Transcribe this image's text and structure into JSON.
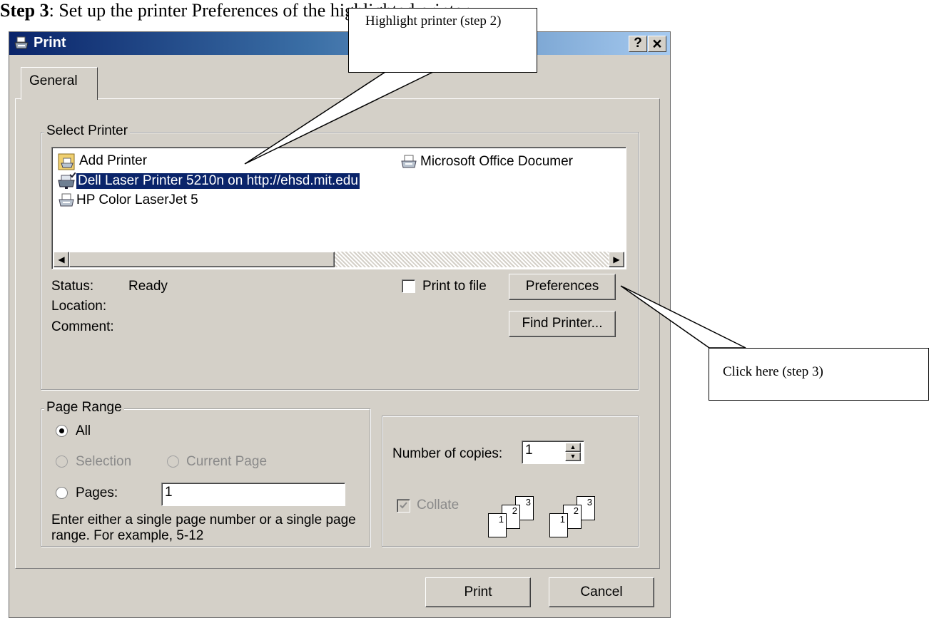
{
  "top_text": {
    "bold": "Step 3",
    "rest": ": Set up the printer Preferences of the highlighted printer"
  },
  "window": {
    "title": "Print",
    "help_label": "?",
    "close_label": "×"
  },
  "tabs": [
    {
      "label": "General"
    }
  ],
  "select_printer": {
    "legend": "Select Printer",
    "printers": [
      {
        "label": "Add Printer",
        "icon": "add-printer-icon"
      },
      {
        "label": "Dell Laser Printer 5210n on http://ehsd.mit.edu",
        "icon": "network-printer-icon",
        "selected": true
      },
      {
        "label": "HP Color LaserJet 5",
        "icon": "printer-icon"
      },
      {
        "label": "Microsoft Office Documer",
        "icon": "printer-icon"
      }
    ],
    "status_label": "Status:",
    "status_value": "Ready",
    "location_label": "Location:",
    "comment_label": "Comment:",
    "print_to_file_label": "Print to file",
    "print_to_file_checked": false,
    "preferences_label": "Preferences",
    "find_printer_label": "Find Printer..."
  },
  "page_range": {
    "legend": "Page Range",
    "all_label": "All",
    "all_selected": true,
    "selection_label": "Selection",
    "current_page_label": "Current Page",
    "pages_label": "Pages:",
    "pages_value": "1",
    "hint": "Enter either a single page number or a single page range.  For example, 5-12"
  },
  "copies": {
    "label": "Number of copies:",
    "value": "1",
    "collate_label": "Collate",
    "collate_checked": true,
    "collate_sheets": [
      "1",
      "2",
      "3"
    ]
  },
  "buttons": {
    "print_label": "Print",
    "cancel_label": "Cancel"
  },
  "callouts": {
    "step2": "Highlight printer (step 2)",
    "step3": "Click here (step 3)"
  },
  "colors": {
    "selection": "#0a246a",
    "dialog_bg": "#d4d0c8",
    "title_start": "#0a246a",
    "title_end": "#a6caf0"
  }
}
